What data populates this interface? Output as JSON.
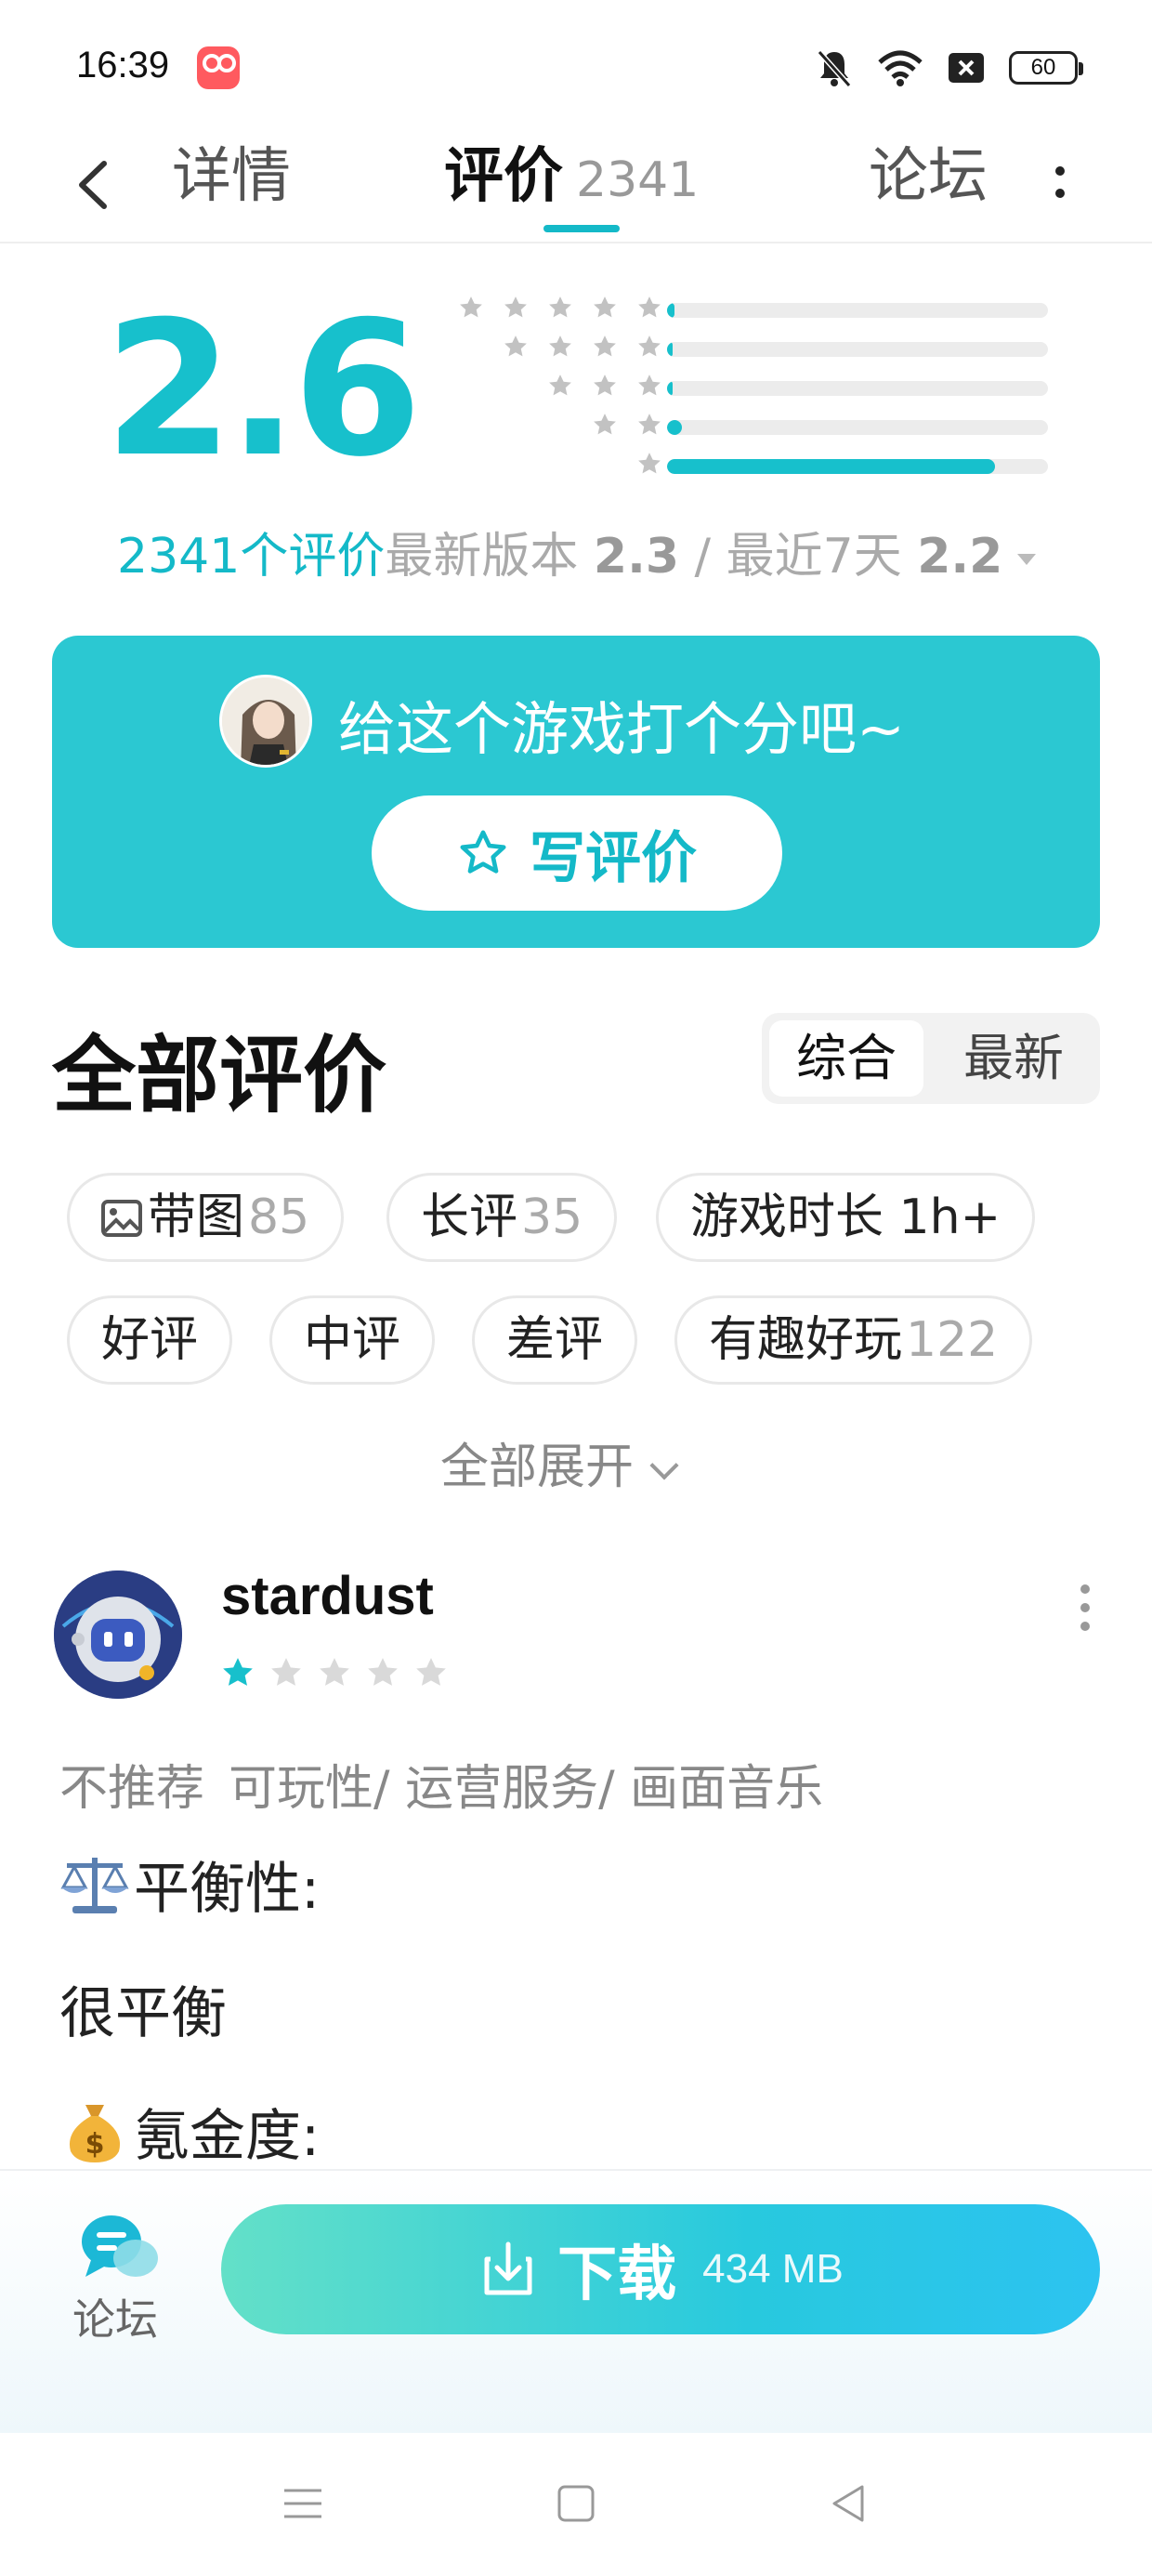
{
  "status_bar": {
    "time": "16:39",
    "battery": "60",
    "icons": [
      "app-notification-icon",
      "mute-bell-icon",
      "wifi-icon",
      "sim-off-icon",
      "battery-icon"
    ]
  },
  "nav": {
    "back_icon": "chevron-left-icon",
    "tabs": [
      {
        "label": "详情"
      },
      {
        "label": "评价",
        "count": "2341",
        "active": true
      },
      {
        "label": "论坛"
      }
    ],
    "more_icon": "vertical-dots-icon"
  },
  "rating": {
    "score": "2.6",
    "distribution": [
      {
        "stars": 5,
        "fraction": 0.02
      },
      {
        "stars": 4,
        "fraction": 0.01
      },
      {
        "stars": 3,
        "fraction": 0.01
      },
      {
        "stars": 2,
        "fraction": 0.04
      },
      {
        "stars": 1,
        "fraction": 0.86
      }
    ],
    "total_label": "2341个评价",
    "latest_version_prefix": "最新版本",
    "latest_version_score": "2.3",
    "separator": "/",
    "recent_prefix": "最近7天",
    "recent_score": "2.2",
    "accent": "#17c0cc"
  },
  "cta": {
    "prompt": "给这个游戏打个分吧~",
    "button_label": "写评价",
    "background": "#2bc8d2"
  },
  "reviews_header": {
    "title": "全部评价",
    "sort_options": [
      "综合",
      "最新"
    ],
    "selected_sort": "综合"
  },
  "filters": {
    "chips": [
      {
        "label": "带图",
        "count": "85",
        "icon": "image-icon"
      },
      {
        "label": "长评",
        "count": "35"
      },
      {
        "label": "游戏时长 1h+"
      },
      {
        "label": "好评"
      },
      {
        "label": "中评"
      },
      {
        "label": "差评"
      },
      {
        "label": "有趣好玩",
        "count": "122"
      }
    ],
    "expand_label": "全部展开"
  },
  "review": {
    "username": "stardust",
    "rating": 1,
    "verdict": "不推荐",
    "tags": "可玩性/ 运营服务/ 画面音乐",
    "lines": [
      "平衡性:",
      "很平衡",
      "氪金度:"
    ],
    "line_icons": [
      "balance-scale-icon",
      "",
      "money-bag-icon"
    ]
  },
  "bottom_bar": {
    "forum_label": "论坛",
    "download_label": "下载",
    "download_size": "434 MB"
  },
  "system_nav": {
    "buttons": [
      "menu-icon",
      "home-square-icon",
      "back-triangle-icon"
    ]
  }
}
